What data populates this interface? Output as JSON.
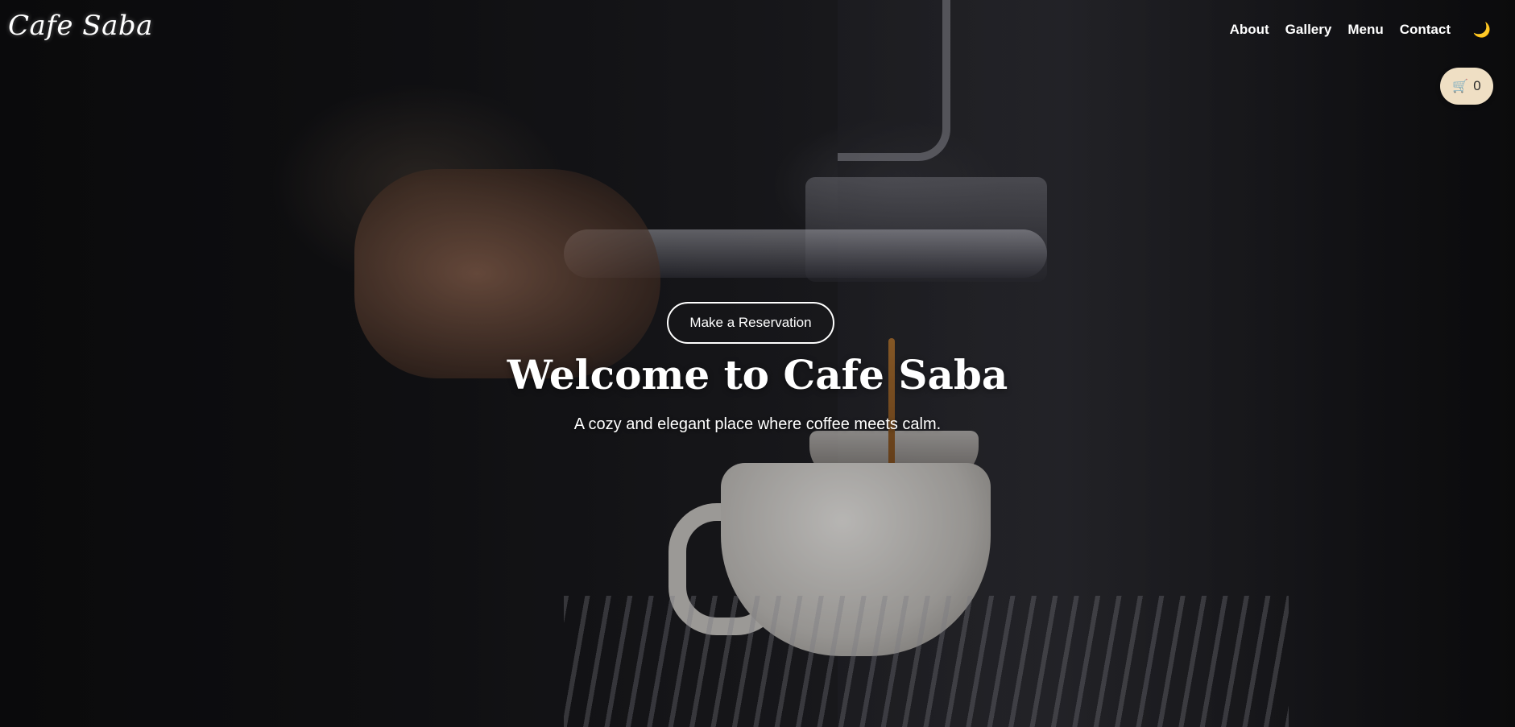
{
  "header": {
    "logo": "Cafe Saba",
    "nav": [
      {
        "label": "About"
      },
      {
        "label": "Gallery"
      },
      {
        "label": "Menu"
      },
      {
        "label": "Contact"
      }
    ],
    "theme_toggle": {
      "icon": "moon-icon",
      "glyph": "🌙"
    },
    "cart": {
      "icon": "cart-icon",
      "glyph": "🛒",
      "count": "0"
    }
  },
  "hero": {
    "cta_label": "Make a Reservation",
    "title": "Welcome to Cafe Saba",
    "subtitle": "A cozy and elegant place where coffee meets calm."
  },
  "colors": {
    "cart_background": "#efdfc4",
    "text": "#ffffff",
    "moon": "#f5b942"
  }
}
